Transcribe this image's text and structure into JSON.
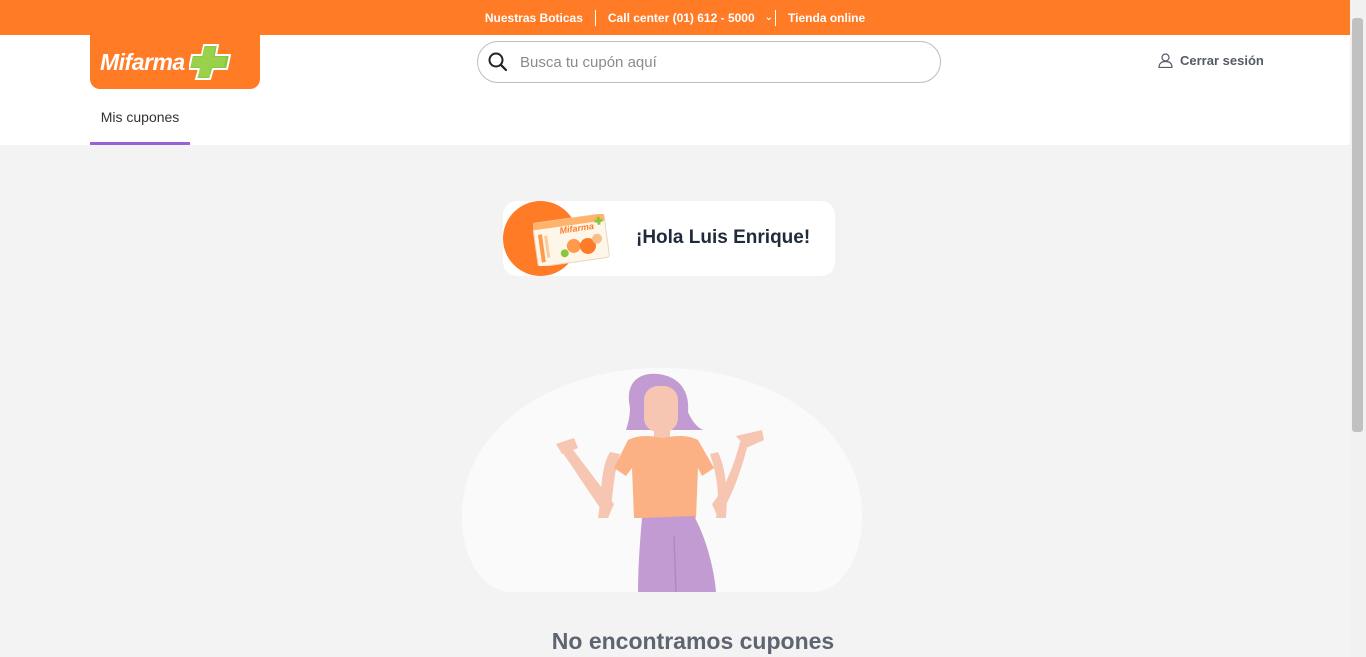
{
  "topbar": {
    "stores_label": "Nuestras Boticas",
    "call_center_label": "Call center (01) 612 - 5000",
    "online_store_label": "Tienda online"
  },
  "header": {
    "logo_text": "Mifarma",
    "search_placeholder": "Busca tu cupón aquí",
    "logout_label": "Cerrar sesión"
  },
  "tabs": [
    {
      "label": "Mis cupones",
      "active": true
    }
  ],
  "greeting": {
    "text": "¡Hola Luis Enrique!"
  },
  "empty_state": {
    "title": "No encontramos cupones"
  },
  "colors": {
    "brand_orange": "#ff7b26",
    "tab_accent": "#9b5fdc",
    "brand_green": "#8cc63f"
  }
}
